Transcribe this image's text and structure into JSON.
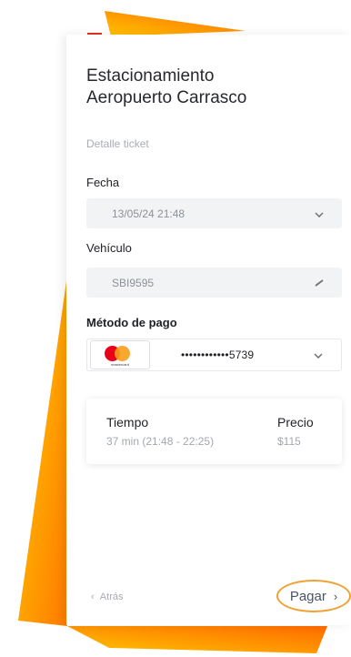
{
  "title_lines": [
    "Estacionamiento",
    "Aeropuerto Carrasco"
  ],
  "section_label": "Detalle ticket",
  "fecha": {
    "label": "Fecha",
    "value": "13/05/24 21:48",
    "icon": "chevron-down-icon"
  },
  "vehiculo": {
    "label": "Vehículo",
    "value": "SBI9595",
    "icon": "pencil-icon"
  },
  "metodo_pago": {
    "label": "Método de pago",
    "card_brand": "mastercard",
    "card_number": "••••••••••••5739",
    "icon": "chevron-down-icon"
  },
  "summary": {
    "tiempo_label": "Tiempo",
    "tiempo_value": "37 min (21:48 - 22:25)",
    "precio_label": "Precio",
    "precio_value": "$115"
  },
  "nav": {
    "back_label": "Atrás",
    "next_label": "Pagar"
  },
  "colors": {
    "accent_orange": "#f0a030",
    "background_gradient": [
      "#ffd200",
      "#ff6a00"
    ]
  }
}
